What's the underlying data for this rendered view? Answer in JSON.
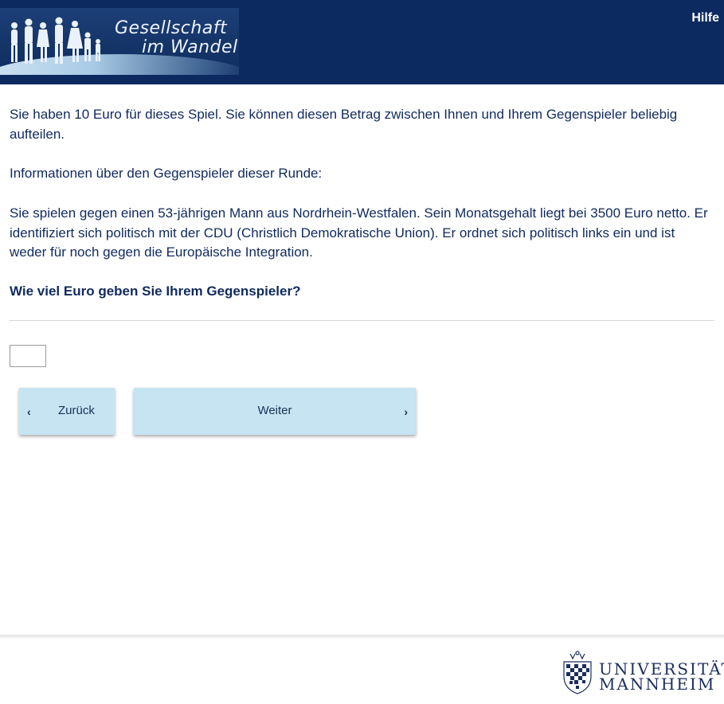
{
  "header": {
    "logo_line1": "Gesellschaft",
    "logo_line2": "im Wandel",
    "help_label": "Hilfe"
  },
  "question": {
    "intro": "Sie haben 10 Euro für dieses Spiel. Sie können diesen Betrag zwischen Ihnen und Ihrem Gegenspieler beliebig aufteilen.",
    "info_heading": "Informationen über den Gegenspieler dieser Runde:",
    "opponent_description": "Sie spielen gegen einen 53-jährigen Mann aus Nordrhein-Westfalen. Sein Monatsgehalt liegt bei 3500 Euro netto. Er identifiziert sich politisch mit der CDU (Christlich Demokratische Union). Er ordnet sich politisch links ein und ist weder für noch gegen die Europäische Integration.",
    "prompt": "Wie viel Euro geben Sie Ihrem Gegenspieler?"
  },
  "input": {
    "value": ""
  },
  "nav": {
    "back_label": "Zurück",
    "next_label": "Weiter"
  },
  "footer": {
    "uni_line1": "UNIVERSITÄT",
    "uni_line2": "MANNHEIM"
  },
  "colors": {
    "header_bg": "#0c2a5f",
    "button_bg": "#c6e4f2",
    "text": "#102a5e"
  }
}
